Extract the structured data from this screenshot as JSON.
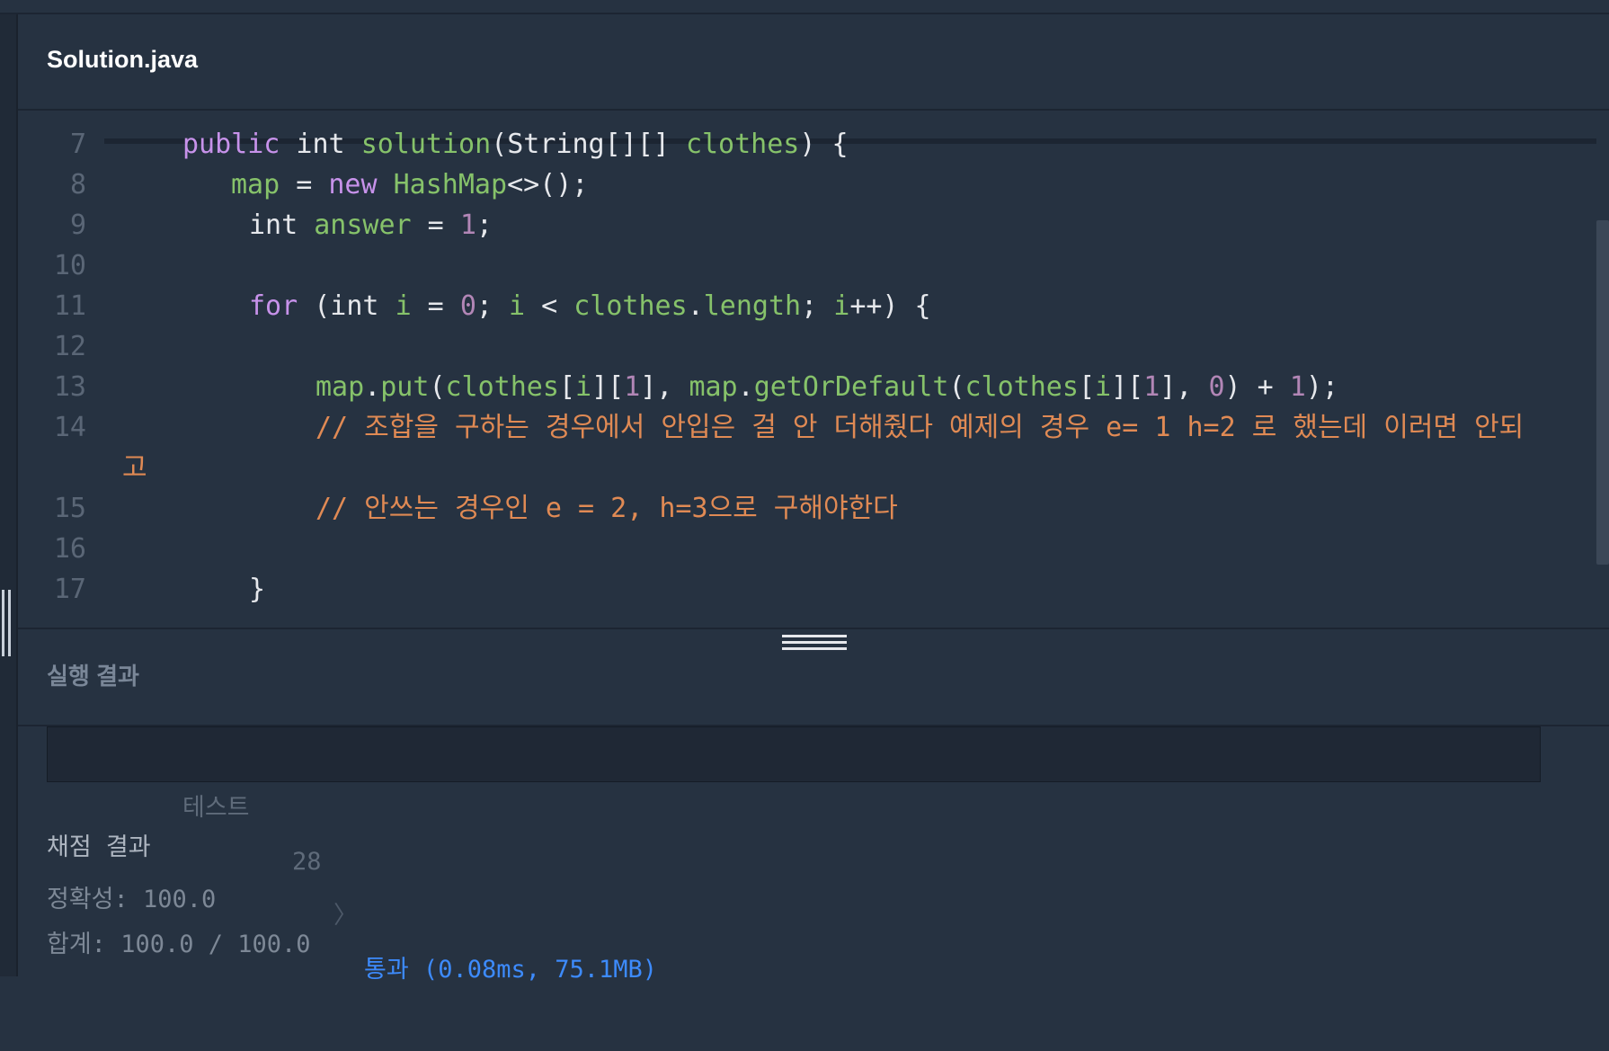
{
  "file": {
    "title": "Solution.java"
  },
  "editor": {
    "lines": [
      {
        "num": "7",
        "indent": 83,
        "tokens": [
          {
            "t": "public",
            "c": "kw"
          },
          {
            "t": " int ",
            "c": "pl"
          },
          {
            "t": "solution",
            "c": "fn"
          },
          {
            "t": "(String[][] ",
            "c": "pl"
          },
          {
            "t": "clothes",
            "c": "var"
          },
          {
            "t": ") {",
            "c": "pl"
          }
        ]
      },
      {
        "num": "8",
        "indent": 137,
        "tokens": [
          {
            "t": "map",
            "c": "var"
          },
          {
            "t": " = ",
            "c": "pl"
          },
          {
            "t": "new",
            "c": "kw"
          },
          {
            "t": " ",
            "c": "pl"
          },
          {
            "t": "HashMap",
            "c": "fn"
          },
          {
            "t": "<>();",
            "c": "pl"
          }
        ]
      },
      {
        "num": "9",
        "indent": 157,
        "tokens": [
          {
            "t": "int ",
            "c": "pl"
          },
          {
            "t": "answer",
            "c": "var"
          },
          {
            "t": " = ",
            "c": "pl"
          },
          {
            "t": "1",
            "c": "num"
          },
          {
            "t": ";",
            "c": "pl"
          }
        ]
      },
      {
        "num": "10",
        "indent": 0,
        "tokens": []
      },
      {
        "num": "11",
        "indent": 157,
        "tokens": [
          {
            "t": "for",
            "c": "kw"
          },
          {
            "t": " (int ",
            "c": "pl"
          },
          {
            "t": "i",
            "c": "var"
          },
          {
            "t": " = ",
            "c": "pl"
          },
          {
            "t": "0",
            "c": "num"
          },
          {
            "t": "; ",
            "c": "pl"
          },
          {
            "t": "i",
            "c": "var"
          },
          {
            "t": " < ",
            "c": "pl"
          },
          {
            "t": "clothes",
            "c": "var"
          },
          {
            "t": ".",
            "c": "pl"
          },
          {
            "t": "length",
            "c": "var"
          },
          {
            "t": "; ",
            "c": "pl"
          },
          {
            "t": "i",
            "c": "var"
          },
          {
            "t": "++) {",
            "c": "pl"
          }
        ]
      },
      {
        "num": "12",
        "indent": 0,
        "tokens": []
      },
      {
        "num": "13",
        "indent": 231,
        "tokens": [
          {
            "t": "map",
            "c": "var"
          },
          {
            "t": ".",
            "c": "pl"
          },
          {
            "t": "put",
            "c": "fn"
          },
          {
            "t": "(",
            "c": "pl"
          },
          {
            "t": "clothes",
            "c": "var"
          },
          {
            "t": "[",
            "c": "pl"
          },
          {
            "t": "i",
            "c": "var"
          },
          {
            "t": "][",
            "c": "pl"
          },
          {
            "t": "1",
            "c": "num"
          },
          {
            "t": "], ",
            "c": "pl"
          },
          {
            "t": "map",
            "c": "var"
          },
          {
            "t": ".",
            "c": "pl"
          },
          {
            "t": "getOrDefault",
            "c": "fn"
          },
          {
            "t": "(",
            "c": "pl"
          },
          {
            "t": "clothes",
            "c": "var"
          },
          {
            "t": "[",
            "c": "pl"
          },
          {
            "t": "i",
            "c": "var"
          },
          {
            "t": "][",
            "c": "pl"
          },
          {
            "t": "1",
            "c": "num"
          },
          {
            "t": "], ",
            "c": "pl"
          },
          {
            "t": "0",
            "c": "num"
          },
          {
            "t": ") + ",
            "c": "pl"
          },
          {
            "t": "1",
            "c": "num"
          },
          {
            "t": ");",
            "c": "pl"
          }
        ]
      },
      {
        "num": "14",
        "indent": 231,
        "tokens": [
          {
            "t": "// 조합을 구하는 경우에서 안입은 걸 안 더해줬다 예제의 경우 e= 1 h=2 로 했는데 이러면 안되",
            "c": "cm"
          }
        ]
      },
      {
        "num": "",
        "indent": 16,
        "tokens": [
          {
            "t": "고",
            "c": "cm"
          }
        ]
      },
      {
        "num": "15",
        "indent": 231,
        "tokens": [
          {
            "t": "// 안쓰는 경우인 e = 2, h=3으로 구해야한다",
            "c": "cm"
          }
        ]
      },
      {
        "num": "16",
        "indent": 0,
        "tokens": []
      },
      {
        "num": "17",
        "indent": 157,
        "tokens": [
          {
            "t": "}",
            "c": "pl"
          }
        ]
      }
    ]
  },
  "result": {
    "title": "실행 결과",
    "test_label": "테스트",
    "test_number": "28",
    "test_chevron": "〉",
    "test_result": "통과 (0.08ms, 75.1MB)"
  },
  "grading": {
    "title": "채점 결과",
    "accuracy": "정확성: 100.0",
    "total": "합계: 100.0 / 100.0"
  },
  "colors": {
    "background": "#263241",
    "keyword": "#c792ea",
    "identifier": "#86c26a",
    "number": "#b286b6",
    "comment": "#e08a54",
    "pass": "#3d8bfd"
  }
}
